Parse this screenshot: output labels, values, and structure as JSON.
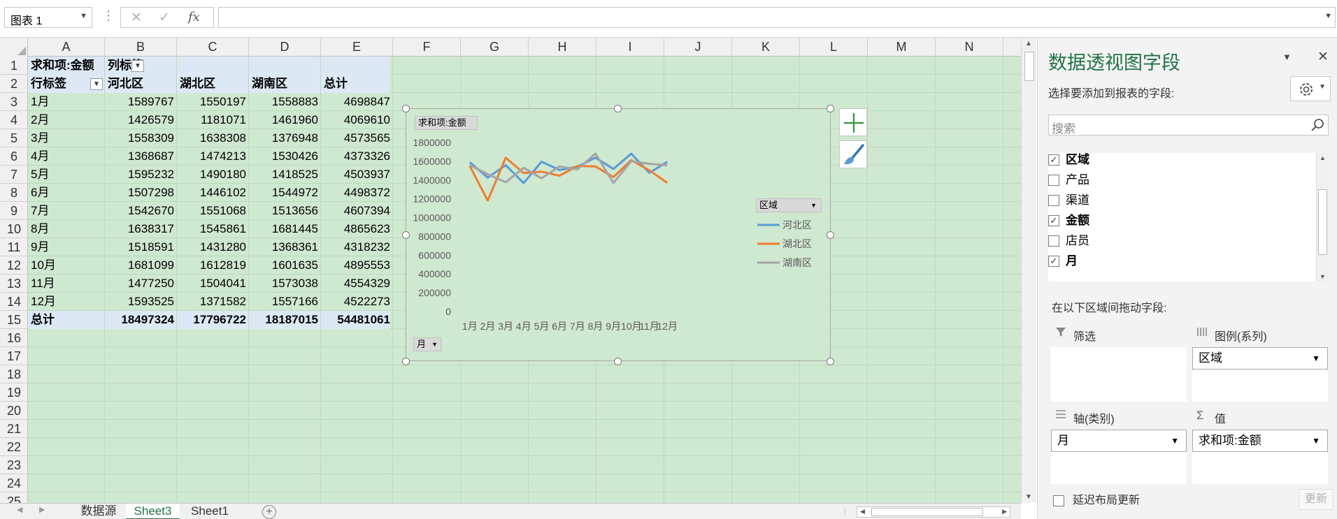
{
  "namebox": {
    "value": "图表 1"
  },
  "formula_bar": {
    "icons": [
      "cancel-icon",
      "enter-icon",
      "function-icon"
    ],
    "fx_label": "fx",
    "value": ""
  },
  "columns": [
    "A",
    "B",
    "C",
    "D",
    "E",
    "F",
    "G",
    "H",
    "I",
    "J",
    "K",
    "L",
    "M",
    "N"
  ],
  "rows": [
    "1",
    "2",
    "3",
    "4",
    "5",
    "6",
    "7",
    "8",
    "9",
    "10",
    "11",
    "12",
    "13",
    "14",
    "15",
    "16",
    "17",
    "18",
    "19",
    "20",
    "21",
    "22",
    "23",
    "24",
    "25"
  ],
  "pivot": {
    "r1a": "求和项:金额",
    "r1b": "列标签",
    "r2a": "行标签",
    "headers": [
      "河北区",
      "湖北区",
      "湖南区",
      "总计"
    ],
    "data": [
      [
        "1月",
        "1589767",
        "1550197",
        "1558883",
        "4698847"
      ],
      [
        "2月",
        "1426579",
        "1181071",
        "1461960",
        "4069610"
      ],
      [
        "3月",
        "1558309",
        "1638308",
        "1376948",
        "4573565"
      ],
      [
        "4月",
        "1368687",
        "1474213",
        "1530426",
        "4373326"
      ],
      [
        "5月",
        "1595232",
        "1490180",
        "1418525",
        "4503937"
      ],
      [
        "6月",
        "1507298",
        "1446102",
        "1544972",
        "4498372"
      ],
      [
        "7月",
        "1542670",
        "1551068",
        "1513656",
        "4607394"
      ],
      [
        "8月",
        "1638317",
        "1545861",
        "1681445",
        "4865623"
      ],
      [
        "9月",
        "1518591",
        "1431280",
        "1368361",
        "4318232"
      ],
      [
        "10月",
        "1681099",
        "1612819",
        "1601635",
        "4895553"
      ],
      [
        "11月",
        "1477250",
        "1504041",
        "1573038",
        "4554329"
      ],
      [
        "12月",
        "1593525",
        "1371582",
        "1557166",
        "4522273"
      ]
    ],
    "total": [
      "总计",
      "18497324",
      "17796722",
      "18187015",
      "54481061"
    ]
  },
  "chart_data": {
    "type": "line",
    "title": "",
    "value_field_button": "求和项:金额",
    "axis_field_button": "月",
    "legend_field_button": "区域",
    "legend_position": "right",
    "categories": [
      "1月",
      "2月",
      "3月",
      "4月",
      "5月",
      "6月",
      "7月",
      "8月",
      "9月",
      "10月",
      "11月",
      "12月"
    ],
    "y_ticks": [
      "1800000",
      "1600000",
      "1400000",
      "1200000",
      "1000000",
      "800000",
      "600000",
      "400000",
      "200000",
      "0"
    ],
    "ylim": [
      0,
      1800000
    ],
    "grid": false,
    "series": [
      {
        "name": "河北区",
        "color": "#5b9bd5",
        "values": [
          1589767,
          1426579,
          1558309,
          1368687,
          1595232,
          1507298,
          1542670,
          1638317,
          1518591,
          1681099,
          1477250,
          1593525
        ]
      },
      {
        "name": "湖北区",
        "color": "#ed7d31",
        "values": [
          1550197,
          1181071,
          1638308,
          1474213,
          1490180,
          1446102,
          1551068,
          1545861,
          1431280,
          1612819,
          1504041,
          1371582
        ]
      },
      {
        "name": "湖南区",
        "color": "#a5a5a5",
        "values": [
          1558883,
          1461960,
          1376948,
          1530426,
          1418525,
          1544972,
          1513656,
          1681445,
          1368361,
          1601635,
          1573038,
          1557166
        ]
      }
    ]
  },
  "chart_tools": [
    "add-chart-element-icon",
    "chart-styles-brush-icon"
  ],
  "sheets": [
    "数据源",
    "Sheet3",
    "Sheet1"
  ],
  "active_sheet": "Sheet3",
  "pane": {
    "title": "数据透视图字段",
    "subtitle": "选择要添加到报表的字段:",
    "search_placeholder": "搜索",
    "fields": [
      {
        "label": "区域",
        "checked": true
      },
      {
        "label": "产品",
        "checked": false
      },
      {
        "label": "渠道",
        "checked": false
      },
      {
        "label": "金额",
        "checked": true
      },
      {
        "label": "店员",
        "checked": false
      },
      {
        "label": "月",
        "checked": true
      }
    ],
    "drag_label": "在以下区域间拖动字段:",
    "zones": {
      "filter": {
        "title": "筛选",
        "item": ""
      },
      "legend": {
        "title": "图例(系列)",
        "item": "区域"
      },
      "axis": {
        "title": "轴(类别)",
        "item": "月"
      },
      "values": {
        "title": "值",
        "item": "求和项:金额"
      }
    },
    "defer_label": "延迟布局更新",
    "update_label": "更新",
    "accent": "#217346"
  }
}
